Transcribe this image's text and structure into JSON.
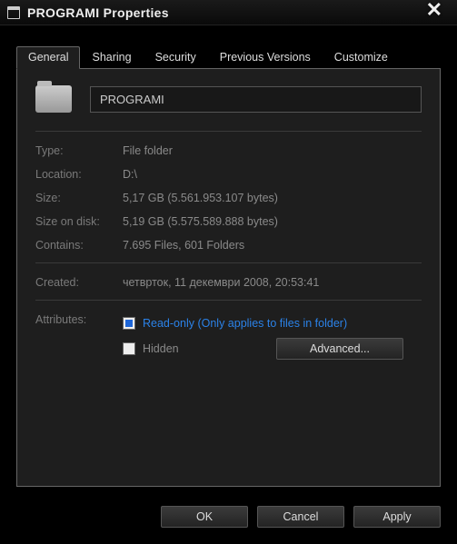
{
  "window": {
    "title": "PROGRAMI Properties"
  },
  "tabs": {
    "general": "General",
    "sharing": "Sharing",
    "security": "Security",
    "previous": "Previous Versions",
    "customize": "Customize"
  },
  "folder": {
    "name": "PROGRAMI"
  },
  "labels": {
    "type": "Type:",
    "location": "Location:",
    "size": "Size:",
    "size_on_disk": "Size on disk:",
    "contains": "Contains:",
    "created": "Created:",
    "attributes": "Attributes:"
  },
  "values": {
    "type": "File folder",
    "location": "D:\\",
    "size": "5,17 GB (5.561.953.107 bytes)",
    "size_on_disk": "5,19 GB (5.575.589.888 bytes)",
    "contains": "7.695 Files, 601 Folders",
    "created": "четврток, 11 декември 2008, 20:53:41"
  },
  "attributes": {
    "readonly_label": "Read-only (Only applies to files in folder)",
    "hidden_label": "Hidden",
    "advanced_btn": "Advanced..."
  },
  "buttons": {
    "ok": "OK",
    "cancel": "Cancel",
    "apply": "Apply"
  }
}
